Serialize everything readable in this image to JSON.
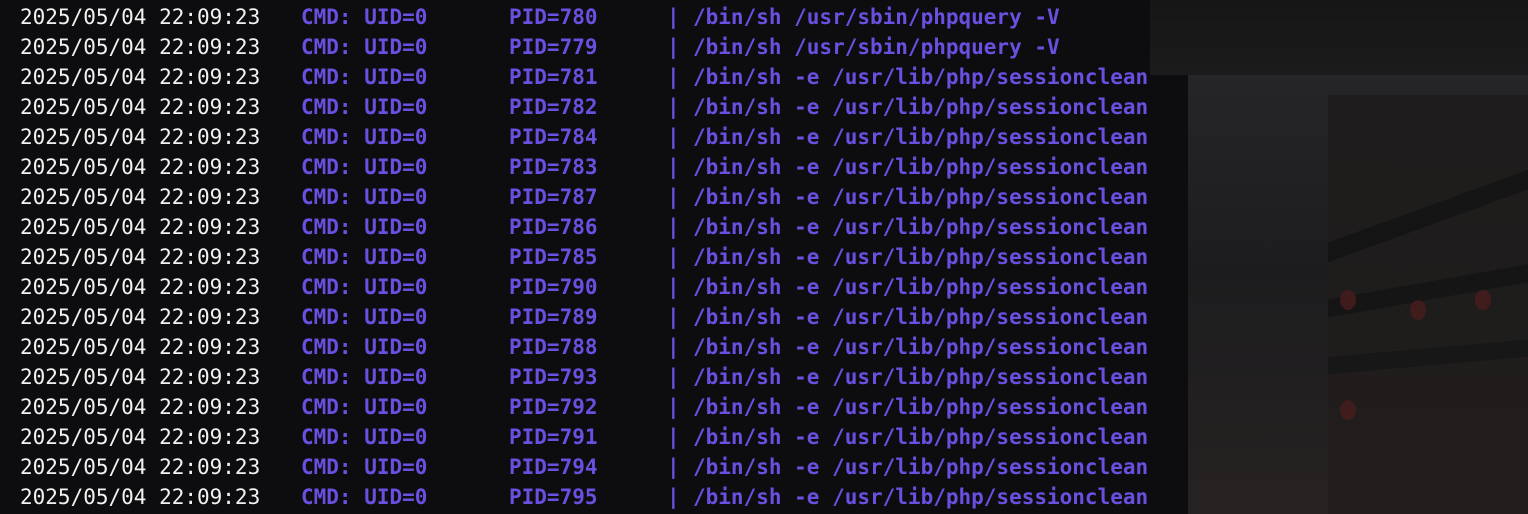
{
  "terminal": {
    "colors": {
      "background": "#0d0d0f",
      "timestamp": "#f2f2f2",
      "highlight": "#6a4fe0"
    },
    "rows": [
      {
        "timestamp": "2025/05/04 22:09:23",
        "cmd": "CMD: UID=0",
        "pid": "PID=780",
        "sep": "|",
        "command": "/bin/sh /usr/sbin/phpquery -V"
      },
      {
        "timestamp": "2025/05/04 22:09:23",
        "cmd": "CMD: UID=0",
        "pid": "PID=779",
        "sep": "|",
        "command": "/bin/sh /usr/sbin/phpquery -V"
      },
      {
        "timestamp": "2025/05/04 22:09:23",
        "cmd": "CMD: UID=0",
        "pid": "PID=781",
        "sep": "|",
        "command": "/bin/sh -e /usr/lib/php/sessionclean"
      },
      {
        "timestamp": "2025/05/04 22:09:23",
        "cmd": "CMD: UID=0",
        "pid": "PID=782",
        "sep": "|",
        "command": "/bin/sh -e /usr/lib/php/sessionclean"
      },
      {
        "timestamp": "2025/05/04 22:09:23",
        "cmd": "CMD: UID=0",
        "pid": "PID=784",
        "sep": "|",
        "command": "/bin/sh -e /usr/lib/php/sessionclean"
      },
      {
        "timestamp": "2025/05/04 22:09:23",
        "cmd": "CMD: UID=0",
        "pid": "PID=783",
        "sep": "|",
        "command": "/bin/sh -e /usr/lib/php/sessionclean"
      },
      {
        "timestamp": "2025/05/04 22:09:23",
        "cmd": "CMD: UID=0",
        "pid": "PID=787",
        "sep": "|",
        "command": "/bin/sh -e /usr/lib/php/sessionclean"
      },
      {
        "timestamp": "2025/05/04 22:09:23",
        "cmd": "CMD: UID=0",
        "pid": "PID=786",
        "sep": "|",
        "command": "/bin/sh -e /usr/lib/php/sessionclean"
      },
      {
        "timestamp": "2025/05/04 22:09:23",
        "cmd": "CMD: UID=0",
        "pid": "PID=785",
        "sep": "|",
        "command": "/bin/sh -e /usr/lib/php/sessionclean"
      },
      {
        "timestamp": "2025/05/04 22:09:23",
        "cmd": "CMD: UID=0",
        "pid": "PID=790",
        "sep": "|",
        "command": "/bin/sh -e /usr/lib/php/sessionclean"
      },
      {
        "timestamp": "2025/05/04 22:09:23",
        "cmd": "CMD: UID=0",
        "pid": "PID=789",
        "sep": "|",
        "command": "/bin/sh -e /usr/lib/php/sessionclean"
      },
      {
        "timestamp": "2025/05/04 22:09:23",
        "cmd": "CMD: UID=0",
        "pid": "PID=788",
        "sep": "|",
        "command": "/bin/sh -e /usr/lib/php/sessionclean"
      },
      {
        "timestamp": "2025/05/04 22:09:23",
        "cmd": "CMD: UID=0",
        "pid": "PID=793",
        "sep": "|",
        "command": "/bin/sh -e /usr/lib/php/sessionclean"
      },
      {
        "timestamp": "2025/05/04 22:09:23",
        "cmd": "CMD: UID=0",
        "pid": "PID=792",
        "sep": "|",
        "command": "/bin/sh -e /usr/lib/php/sessionclean"
      },
      {
        "timestamp": "2025/05/04 22:09:23",
        "cmd": "CMD: UID=0",
        "pid": "PID=791",
        "sep": "|",
        "command": "/bin/sh -e /usr/lib/php/sessionclean"
      },
      {
        "timestamp": "2025/05/04 22:09:23",
        "cmd": "CMD: UID=0",
        "pid": "PID=794",
        "sep": "|",
        "command": "/bin/sh -e /usr/lib/php/sessionclean"
      },
      {
        "timestamp": "2025/05/04 22:09:23",
        "cmd": "CMD: UID=0",
        "pid": "PID=795",
        "sep": "|",
        "command": "/bin/sh -e /usr/lib/php/sessionclean"
      }
    ]
  }
}
